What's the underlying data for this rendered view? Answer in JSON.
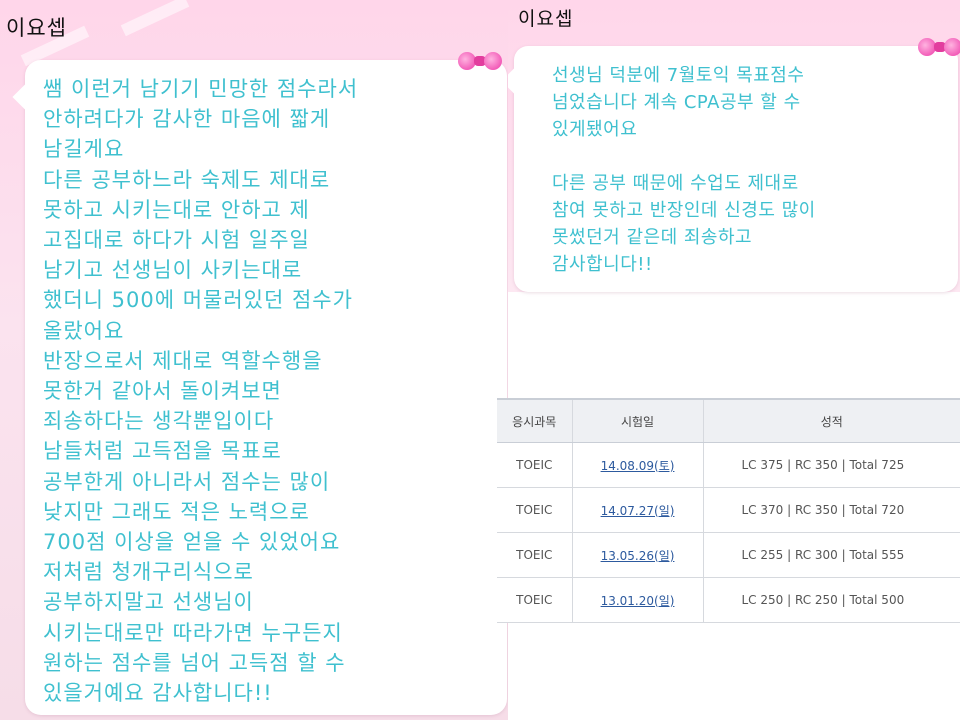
{
  "left_post": {
    "author": "이요셉",
    "message": "쌤 이런거 남기기 민망한 점수라서\n안하려다가 감사한 마음에 짧게\n남길게요\n다른 공부하느라 숙제도 제대로\n못하고 시키는대로 안하고 제\n고집대로 하다가 시험 일주일\n남기고 선생님이 사키는대로\n했더니 500에 머물러있던 점수가\n올랐어요\n반장으로서 제대로 역할수행을\n못한거 같아서 돌이켜보면\n죄송하다는 생각뿐입이다\n남들처럼 고득점을 목표로\n공부한게 아니라서 점수는 많이\n낮지만 그래도 적은 노력으로\n700점 이상을 얻을 수 있었어요\n저처럼 청개구리식으로\n공부하지말고 선생님이\n시키는대로만 따라가면 누구든지\n원하는 점수를 넘어 고득점 할 수\n있을거예요 감사합니다!!"
  },
  "right_post": {
    "author": "이요셉",
    "message": "선생님 덕분에 7월토익 목표점수\n넘었습니다 계속 CPA공부 할 수\n있게됐어요\n\n다른 공부 때문에 수업도 제대로\n참여 못하고 반장인데 신경도 많이\n못썼던거 같은데 죄송하고\n감사합니다!!"
  },
  "score_table": {
    "headers": [
      "응시과목",
      "시험일",
      "성적"
    ],
    "rows": [
      {
        "subject": "TOEIC",
        "date": "14.08.09(토)",
        "score": "LC 375 | RC 350 | Total 725"
      },
      {
        "subject": "TOEIC",
        "date": "14.07.27(일)",
        "score": "LC 370 | RC 350 | Total 720"
      },
      {
        "subject": "TOEIC",
        "date": "13.05.26(일)",
        "score": "LC 255 | RC 300 | Total 555"
      },
      {
        "subject": "TOEIC",
        "date": "13.01.20(일)",
        "score": "LC 250 | RC 250 | Total 500"
      }
    ]
  },
  "colors": {
    "message_text": "#3fc0cf",
    "panel_pink": "#ffd6ea",
    "bow_pink": "#f25cb8",
    "date_link": "#2d5a9e"
  },
  "icons": [
    "bow-icon"
  ]
}
